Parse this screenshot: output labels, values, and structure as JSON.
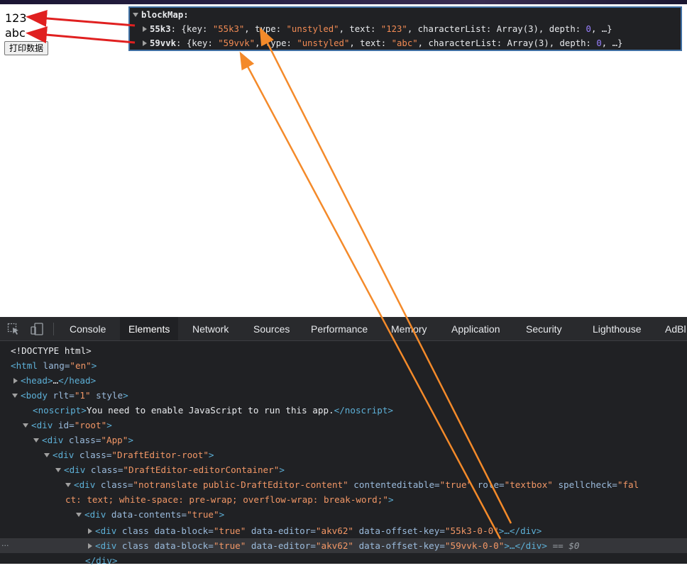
{
  "editor": {
    "line1": "123",
    "line2": "abc",
    "print_button": "打印数据"
  },
  "console_popup": {
    "header": "blockMap:",
    "entries": [
      {
        "key_label": "55k3",
        "open": ": {key: ",
        "key_val": "\"55k3\"",
        "type_label": ", type: ",
        "type_val": "\"unstyled\"",
        "text_label": ", text: ",
        "text_val": "\"123\"",
        "cl_label": ", characterList: Array(3), depth: ",
        "depth_val": "0",
        "tail": ", …}"
      },
      {
        "key_label": "59vvk",
        "open": ": {key: ",
        "key_val": "\"59vvk\"",
        "type_label": ", type: ",
        "type_val": "\"unstyled\"",
        "text_label": ", text: ",
        "text_val": "\"abc\"",
        "cl_label": ", characterList: Array(3), depth: ",
        "depth_val": "0",
        "tail": ", …}"
      }
    ]
  },
  "devtools": {
    "tabs": [
      "Console",
      "Elements",
      "Network",
      "Sources",
      "Performance",
      "Memory",
      "Application",
      "Security",
      "Lighthouse",
      "AdBl"
    ],
    "active_tab": "Elements",
    "dom": {
      "doctype": "<!DOCTYPE html>",
      "html_open": "<html",
      "html_lang_attr": " lang=",
      "html_lang_val": "\"en\"",
      "html_close": ">",
      "head": "<head>",
      "head_ellipsis": "…",
      "head_close": "</head>",
      "body_open": "<body",
      "body_attrs": " rlt=",
      "body_rlt_val": "\"1\"",
      "body_style": " style",
      "body_close": ">",
      "noscript_open": "<noscript>",
      "noscript_text": "You need to enable JavaScript to run this app.",
      "noscript_close": "</noscript>",
      "div_root_open": "<div",
      "div_root_attr": " id=",
      "div_root_val": "\"root\"",
      "div_app_attr": " class=",
      "div_app_val": "\"App\"",
      "div_der_val": "\"DraftEditor-root\"",
      "div_dec_val": "\"DraftEditor-editorContainer\"",
      "content_class_val": "\"notranslate public-DraftEditor-content\"",
      "content_ce_attr": " contenteditable=",
      "content_ce_val": "\"true\"",
      "content_role_attr": " role=",
      "content_role_val": "\"textbox\"",
      "content_spell_attr": " spellcheck=",
      "content_spell_val": "\"fal",
      "content_cont_val": "ct: text; white-space: pre-wrap; overflow-wrap: break-word;\"",
      "div_contents_attr": " data-contents=",
      "div_contents_val": "\"true\"",
      "block_div": "<div",
      "block_class": " class",
      "block_attr1": " data-block=",
      "block_val1": "\"true\"",
      "block_attr2": " data-editor=",
      "block_val2": "\"akv62\"",
      "block_attr3": " data-offset-key=",
      "block1_val3": "\"55k3-0-0\"",
      "block2_val3": "\"59vvk-0-0\"",
      "block_end": ">…</div>",
      "selected_note": " == $0",
      "div_close": "</div>",
      "gutter_dots": "···"
    }
  },
  "colors": {
    "popup_border": "#3f6fa3",
    "red_arrow": "#e02020",
    "orange_arrow": "#f48a2a"
  },
  "icons": [
    "inspect-element-icon",
    "device-toolbar-icon"
  ]
}
